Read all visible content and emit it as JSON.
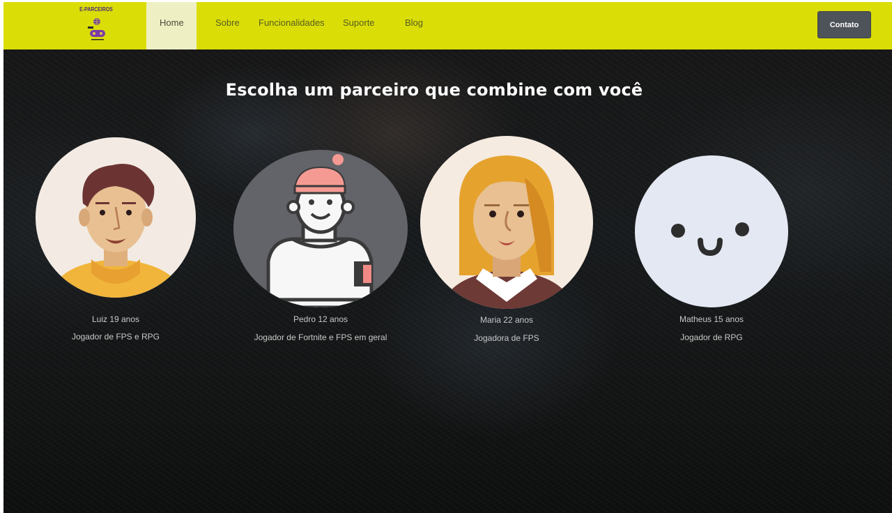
{
  "brand": {
    "name": "E-PARCEIROS"
  },
  "nav": {
    "items": [
      {
        "label": "Home"
      },
      {
        "label": "Sobre"
      },
      {
        "label": "Funcionalidades"
      },
      {
        "label": "Suporte"
      },
      {
        "label": "Blog"
      }
    ],
    "active": "Home",
    "contact_label": "Contato"
  },
  "hero": {
    "title": "Escolha um parceiro que combine com você",
    "partners": [
      {
        "name": "Luiz 19 anos",
        "description": "Jogador de FPS e RPG",
        "avatar_icon": "man-avatar-icon"
      },
      {
        "name": "Pedro 12 anos",
        "description": "Jogador de Fortnite e FPS em geral",
        "avatar_icon": "beanie-person-avatar-icon"
      },
      {
        "name": "Maria 22 anos",
        "description": "Jogadora de FPS",
        "avatar_icon": "woman-avatar-icon"
      },
      {
        "name": "Matheus 15 anos",
        "description": "Jogador de RPG",
        "avatar_icon": "smiley-face-avatar-icon"
      }
    ]
  },
  "colors": {
    "navbar": "#dbde06",
    "nav_active": "#eef0c4",
    "contact_button": "#4e5359",
    "hero_dark": "#161616"
  }
}
